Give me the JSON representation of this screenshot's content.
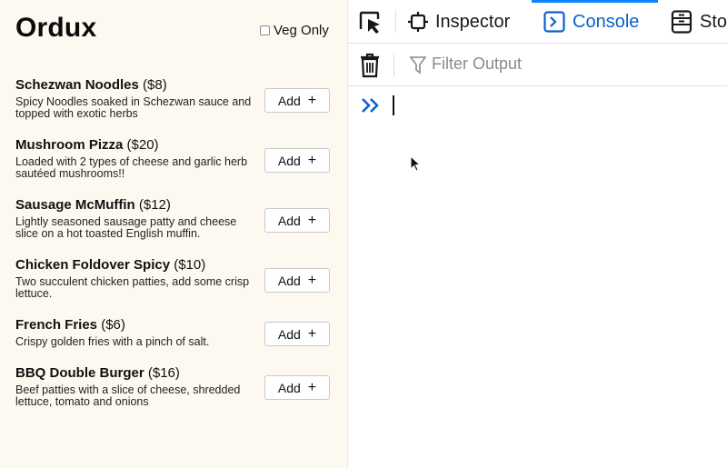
{
  "app": {
    "title": "Ordux",
    "veg_only_label": "Veg Only",
    "veg_only_checked": false,
    "menu": [
      {
        "name": "Schezwan Noodles",
        "price": "($8)",
        "description": "Spicy Noodles soaked in Schezwan sauce and topped with exotic herbs",
        "button": "Add"
      },
      {
        "name": "Mushroom Pizza",
        "price": "($20)",
        "description": "Loaded with 2 types of cheese and garlic herb sautéed mushrooms!!",
        "button": "Add"
      },
      {
        "name": "Sausage McMuffin",
        "price": "($12)",
        "description": "Lightly seasoned sausage patty and cheese slice on a hot toasted English muffin.",
        "button": "Add"
      },
      {
        "name": "Chicken Foldover Spicy",
        "price": "($10)",
        "description": "Two succulent chicken patties, add some crisp lettuce.",
        "button": "Add"
      },
      {
        "name": "French Fries",
        "price": "($6)",
        "description": "Crispy golden fries with a pinch of salt.",
        "button": "Add"
      },
      {
        "name": "BBQ Double Burger",
        "price": "($16)",
        "description": "Beef patties with a slice of cheese, shredded lettuce, tomato and onions",
        "button": "Add"
      }
    ]
  },
  "devtools": {
    "tabs": [
      {
        "label": "Inspector",
        "icon": "inspector-icon",
        "active": false
      },
      {
        "label": "Console",
        "icon": "console-icon",
        "active": true
      },
      {
        "label": "Sto",
        "icon": "storage-icon",
        "active": false
      }
    ],
    "filter_placeholder": "Filter Output",
    "accent_color": "#0a61cf"
  }
}
